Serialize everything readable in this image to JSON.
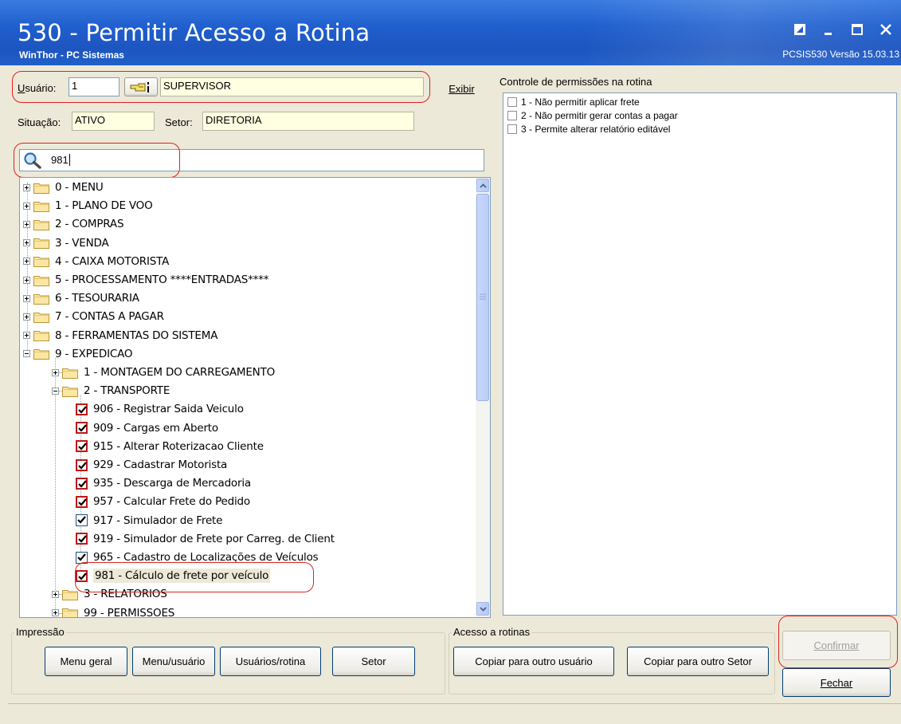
{
  "window": {
    "title": "530 - Permitir Acesso a Rotina",
    "subtitle": "WinThor - PC Sistemas",
    "version_info": "PCSIS530  Versão 15.03.13"
  },
  "user": {
    "label": "Usuário:",
    "code": "1",
    "name": "SUPERVISOR",
    "show_button": "Exibir",
    "situation_label": "Situação:",
    "situation": "ATIVO",
    "sector_label": "Setor:",
    "sector": "DIRETORIA"
  },
  "search": {
    "value": "981"
  },
  "tree": {
    "items": [
      {
        "label": "0 - MENU",
        "type": "folder",
        "level": 0,
        "expander": "plus"
      },
      {
        "label": "1 - PLANO DE VOO",
        "type": "folder",
        "level": 0,
        "expander": "plus"
      },
      {
        "label": "2 - COMPRAS",
        "type": "folder",
        "level": 0,
        "expander": "plus"
      },
      {
        "label": "3 - VENDA",
        "type": "folder",
        "level": 0,
        "expander": "plus"
      },
      {
        "label": "4 - CAIXA MOTORISTA",
        "type": "folder",
        "level": 0,
        "expander": "plus"
      },
      {
        "label": "5 - PROCESSAMENTO ****ENTRADAS****",
        "type": "folder",
        "level": 0,
        "expander": "plus"
      },
      {
        "label": "6 - TESOURARIA",
        "type": "folder",
        "level": 0,
        "expander": "plus"
      },
      {
        "label": "7 - CONTAS A PAGAR",
        "type": "folder",
        "level": 0,
        "expander": "plus"
      },
      {
        "label": "8 - FERRAMENTAS DO SISTEMA",
        "type": "folder",
        "level": 0,
        "expander": "plus"
      },
      {
        "label": "9 - EXPEDICAO",
        "type": "folder",
        "level": 0,
        "expander": "minus"
      },
      {
        "label": "1 - MONTAGEM DO CARREGAMENTO",
        "type": "folder",
        "level": 1,
        "expander": "plus"
      },
      {
        "label": "2 - TRANSPORTE",
        "type": "folder",
        "level": 1,
        "expander": "minus"
      },
      {
        "label": "906 - Registrar Saida Veiculo",
        "type": "check",
        "level": 2,
        "red": true
      },
      {
        "label": "909 - Cargas em Aberto",
        "type": "check",
        "level": 2,
        "red": true
      },
      {
        "label": "915 - Alterar Roterizacao Cliente",
        "type": "check",
        "level": 2,
        "red": true
      },
      {
        "label": "929 - Cadastrar Motorista",
        "type": "check",
        "level": 2,
        "red": true
      },
      {
        "label": "935 - Descarga de Mercadoria",
        "type": "check",
        "level": 2,
        "red": true
      },
      {
        "label": "957 - Calcular Frete do Pedido",
        "type": "check",
        "level": 2,
        "red": true
      },
      {
        "label": "917 - Simulador de Frete",
        "type": "check",
        "level": 2,
        "red": false
      },
      {
        "label": "919 - Simulador de Frete por Carreg. de Client",
        "type": "check",
        "level": 2,
        "red": true
      },
      {
        "label": "965 - Cadastro de Localizações de Veículos",
        "type": "check",
        "level": 2,
        "red": false
      },
      {
        "label": "981 - Cálculo de frete por veículo",
        "type": "check",
        "level": 2,
        "red": true,
        "selected": true
      },
      {
        "label": "3 - RELATORIOS",
        "type": "folder",
        "level": 1,
        "expander": "plus"
      },
      {
        "label": "99 - PERMISSOES",
        "type": "folder",
        "level": 1,
        "expander": "plus"
      }
    ]
  },
  "permissions": {
    "title": "Controle de permissões na rotina",
    "items": [
      "1 - Não permitir aplicar frete",
      "2 - Não permitir gerar contas a pagar",
      "3 - Permite alterar relatório editável"
    ]
  },
  "print_group": {
    "title": "Impressão",
    "buttons": [
      "Menu geral",
      "Menu/usuário",
      "Usuários/rotina",
      "Setor"
    ]
  },
  "access_group": {
    "title": "Acesso a rotinas",
    "buttons": [
      "Copiar para outro usuário",
      "Copiar para outro Setor"
    ]
  },
  "actions": {
    "confirm": "Confirmar",
    "close": "Fechar"
  },
  "colors": {
    "title_bar": "#1f5fce",
    "highlight": "#e02020",
    "field_bg": "#ffffe1",
    "check_red": "#c01818"
  }
}
